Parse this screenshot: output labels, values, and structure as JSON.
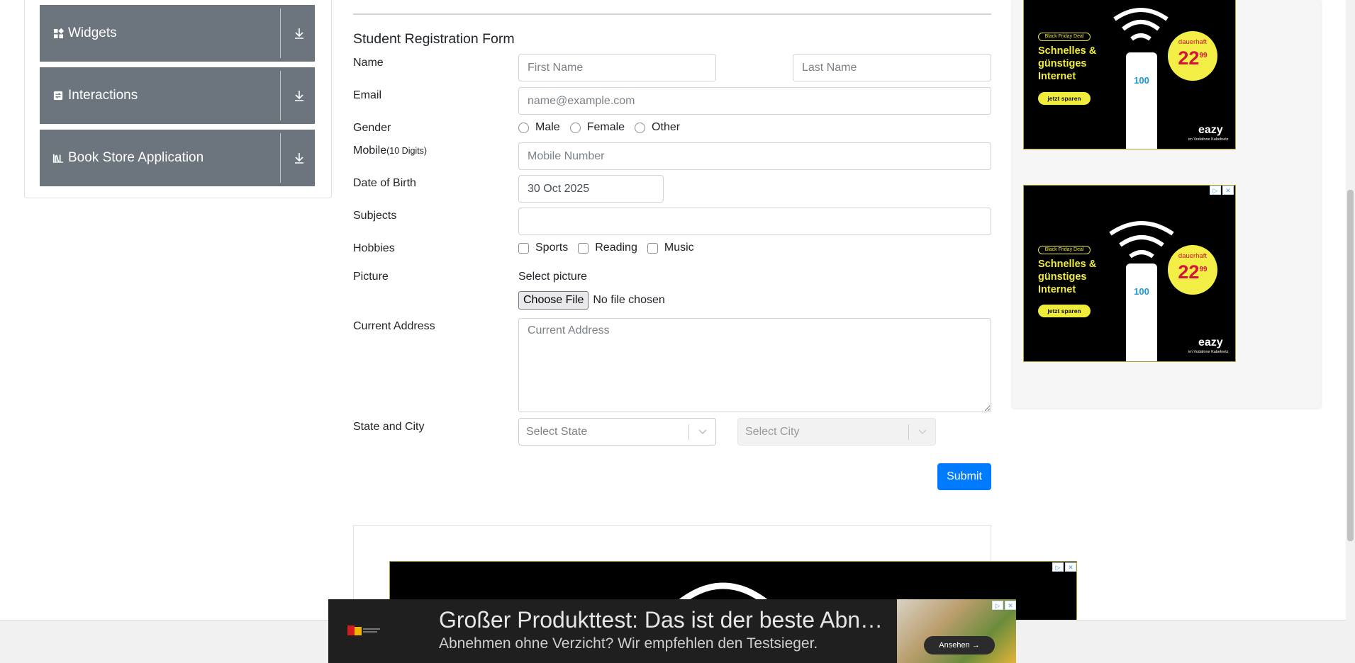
{
  "sidebar": {
    "items": [
      {
        "label": "Widgets",
        "icon": "widgets-icon"
      },
      {
        "label": "Interactions",
        "icon": "interactions-icon"
      },
      {
        "label": "Book Store Application",
        "icon": "book-store-icon"
      }
    ]
  },
  "form": {
    "title": "Student Registration Form",
    "name_label": "Name",
    "first_name_placeholder": "First Name",
    "last_name_placeholder": "Last Name",
    "email_label": "Email",
    "email_placeholder": "name@example.com",
    "gender_label": "Gender",
    "gender_options": [
      "Male",
      "Female",
      "Other"
    ],
    "mobile_label": "Mobile",
    "mobile_hint": "(10 Digits)",
    "mobile_placeholder": "Mobile Number",
    "dob_label": "Date of Birth",
    "dob_value": "30 Oct 2025",
    "subjects_label": "Subjects",
    "hobbies_label": "Hobbies",
    "hobbies_options": [
      "Sports",
      "Reading",
      "Music"
    ],
    "picture_label": "Picture",
    "select_picture": "Select picture",
    "choose_file": "Choose File",
    "no_file": "No file chosen",
    "address_label": "Current Address",
    "address_placeholder": "Current Address",
    "state_city_label": "State and City",
    "state_placeholder": "Select State",
    "city_placeholder": "Select City",
    "submit_label": "Submit"
  },
  "side_ads": [
    {
      "deal": "Black Friday Deal",
      "headline": "Schnelles & günstiges Internet",
      "cta": "jetzt sparen",
      "badge_top": "dauerhaft",
      "price": "22",
      "price_cents": "99",
      "currency": "€",
      "speed": "100",
      "brand": "eazy",
      "brand_sub": "im Vodafone Kabelnetz"
    },
    {
      "deal": "Black Friday Deal",
      "headline": "Schnelles & günstiges Internet",
      "cta": "jetzt sparen",
      "badge_top": "dauerhaft",
      "price": "22",
      "price_cents": "99",
      "currency": "€",
      "speed": "100",
      "brand": "eazy",
      "brand_sub": "im Vodafone Kabelnetz"
    }
  ],
  "bottom_banner": {
    "headline": "Großer Produkttest: Das ist der beste Abn…",
    "subline": "Abnehmen ohne Verzicht? Wir empfehlen den Testsieger.",
    "cta": "Ansehen →"
  },
  "colors": {
    "accordion_bg": "#6c757d",
    "submit_bg": "#007bff",
    "ad_yellow": "#f0ec3c"
  }
}
